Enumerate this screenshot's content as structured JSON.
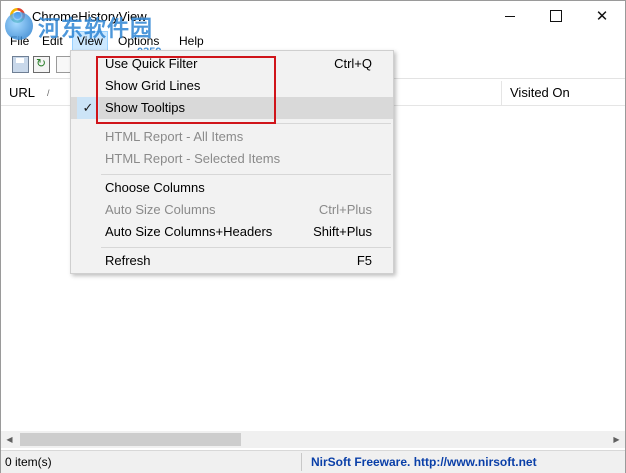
{
  "window": {
    "title": "ChromeHistoryView",
    "minimize_label": "—",
    "close_label": "✕"
  },
  "watermark": {
    "text": "河东软件园",
    "sub": "0359"
  },
  "menubar": [
    "File",
    "Edit",
    "View",
    "Options",
    "Help"
  ],
  "list": {
    "columns": [
      "URL",
      "Visited On"
    ],
    "sort_indicator": "/"
  },
  "scrollbar": {
    "left_arrow": "◀",
    "right_arrow": "▶"
  },
  "status": {
    "items": "0 item(s)",
    "credit": "NirSoft Freeware.  http://www.nirsoft.net"
  },
  "view_menu": {
    "items": [
      {
        "label": "Use Quick Filter",
        "shortcut": "Ctrl+Q",
        "enabled": true,
        "checked": false
      },
      {
        "label": "Show Grid Lines",
        "shortcut": "",
        "enabled": true,
        "checked": false
      },
      {
        "label": "Show Tooltips",
        "shortcut": "",
        "enabled": true,
        "checked": true
      },
      {
        "label": "HTML Report - All Items",
        "shortcut": "",
        "enabled": false,
        "checked": false
      },
      {
        "label": "HTML Report - Selected Items",
        "shortcut": "",
        "enabled": false,
        "checked": false
      },
      {
        "label": "Choose Columns",
        "shortcut": "",
        "enabled": true,
        "checked": false
      },
      {
        "label": "Auto Size Columns",
        "shortcut": "Ctrl+Plus",
        "enabled": false,
        "checked": false
      },
      {
        "label": "Auto Size Columns+Headers",
        "shortcut": "Shift+Plus",
        "enabled": true,
        "checked": false
      },
      {
        "label": "Refresh",
        "shortcut": "F5",
        "enabled": true,
        "checked": false
      }
    ],
    "check_glyph": "✓"
  },
  "colors": {
    "highlight_border": "#d0141a",
    "menu_active": "#cce8ff",
    "status_link": "#0a3fa8"
  }
}
